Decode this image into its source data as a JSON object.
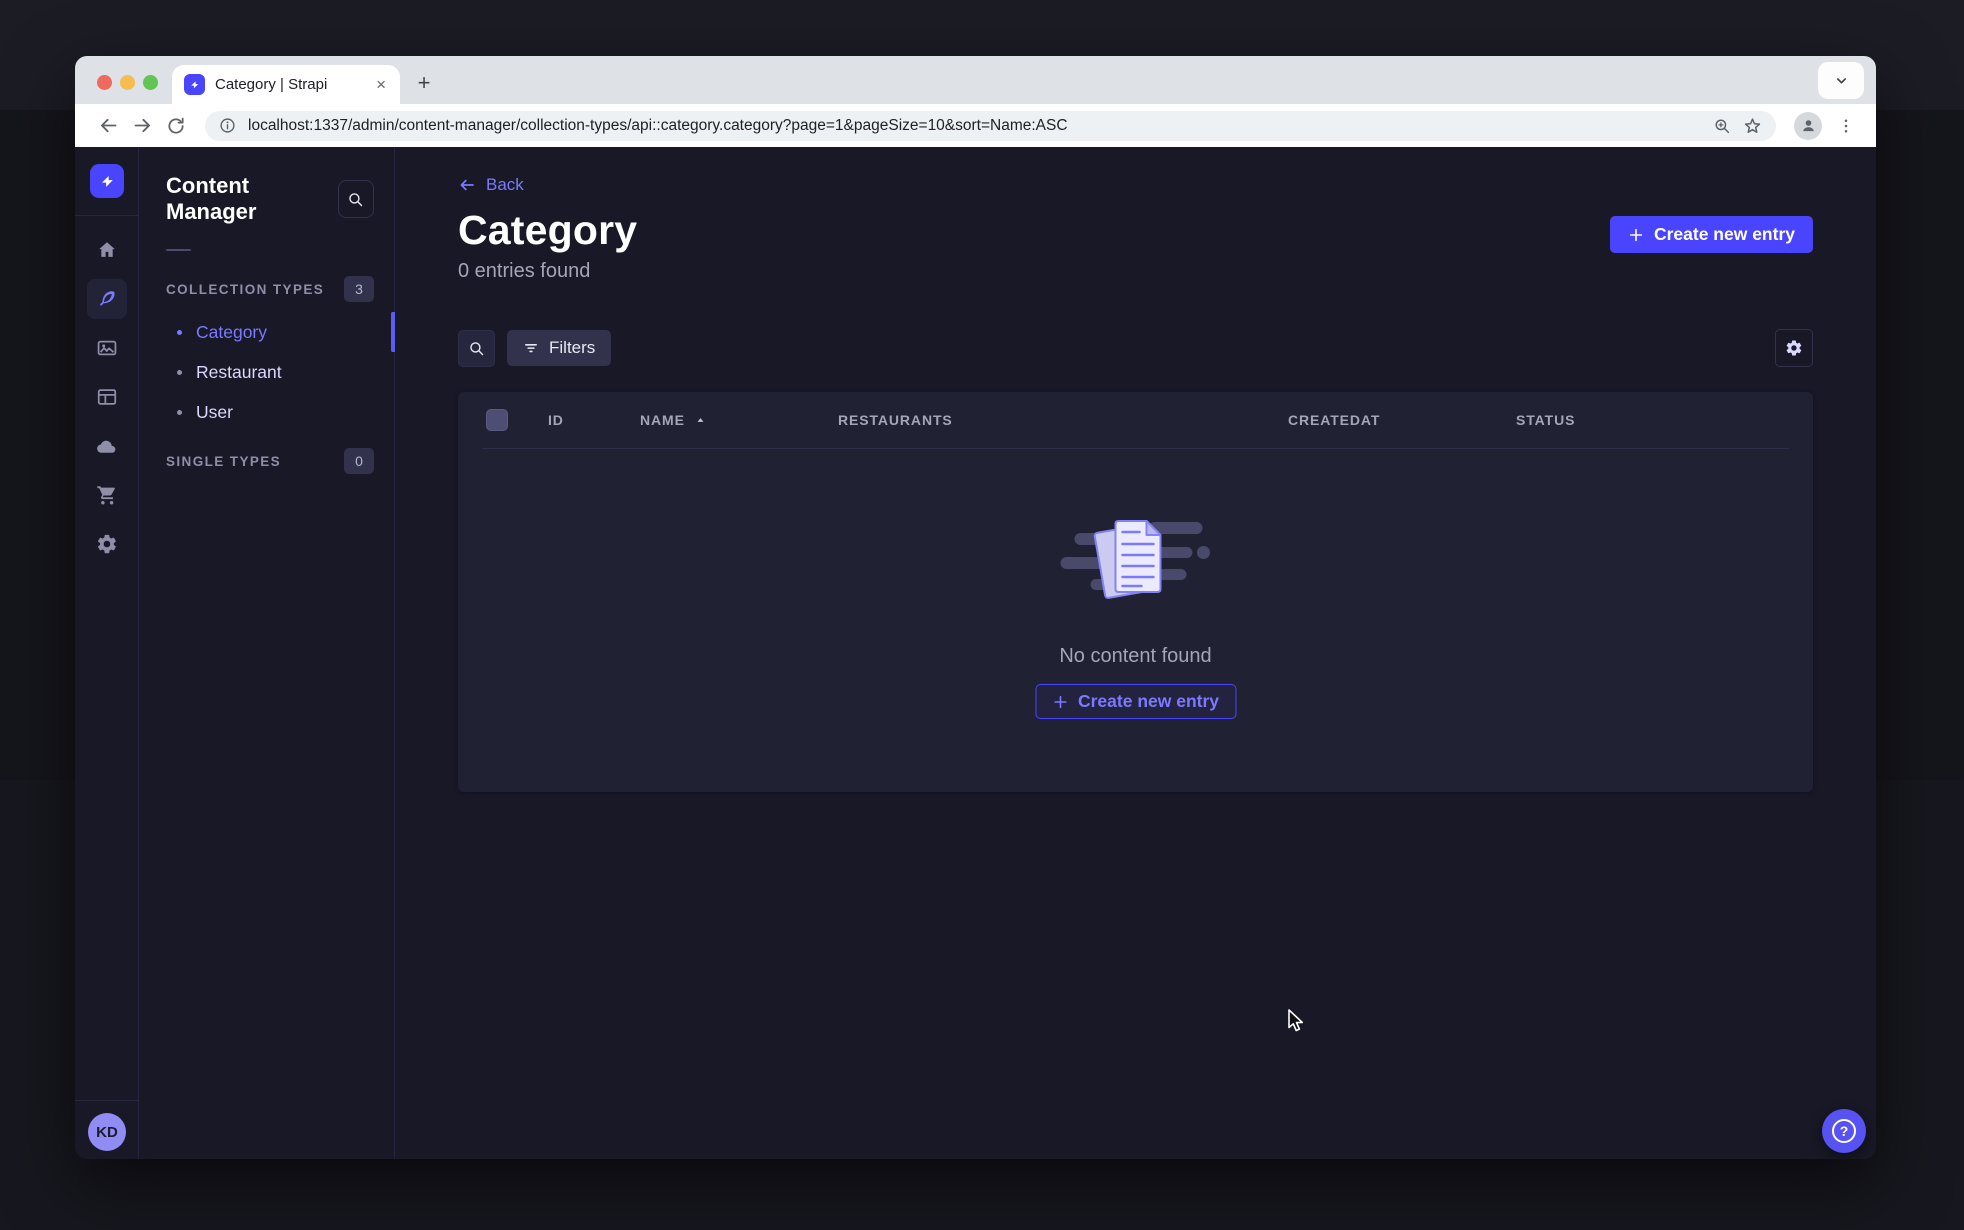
{
  "browser": {
    "tab": {
      "title": "Category | Strapi",
      "close_glyph": "×"
    },
    "new_tab_glyph": "+",
    "url": "localhost:1337/admin/content-manager/collection-types/api::category.category?page=1&pageSize=10&sort=Name:ASC"
  },
  "app": {
    "sidebar": {
      "title": "Content Manager",
      "sections": [
        {
          "label": "COLLECTION TYPES",
          "badge": "3"
        },
        {
          "label": "SINGLE TYPES",
          "badge": "0"
        }
      ],
      "collection_items": [
        {
          "label": "Category",
          "active": true
        },
        {
          "label": "Restaurant",
          "active": false
        },
        {
          "label": "User",
          "active": false
        }
      ]
    },
    "header": {
      "back_label": "Back",
      "title": "Category",
      "subtitle": "0 entries found",
      "create_label": "Create new entry"
    },
    "filters": {
      "label": "Filters"
    },
    "table": {
      "columns": [
        "ID",
        "NAME",
        "RESTAURANTS",
        "CREATEDAT",
        "STATUS"
      ],
      "sorted_column": "NAME",
      "sort_direction": "ASC",
      "rows": []
    },
    "empty_state": {
      "message": "No content found",
      "create_label": "Create new entry"
    },
    "user_initials": "KD"
  },
  "colors": {
    "primary": "#4945ff",
    "primary_text": "#7b79ff",
    "app_bg": "#181826",
    "surface": "#212134",
    "border": "#32324d",
    "chrome_strip": "#dee1e6"
  }
}
